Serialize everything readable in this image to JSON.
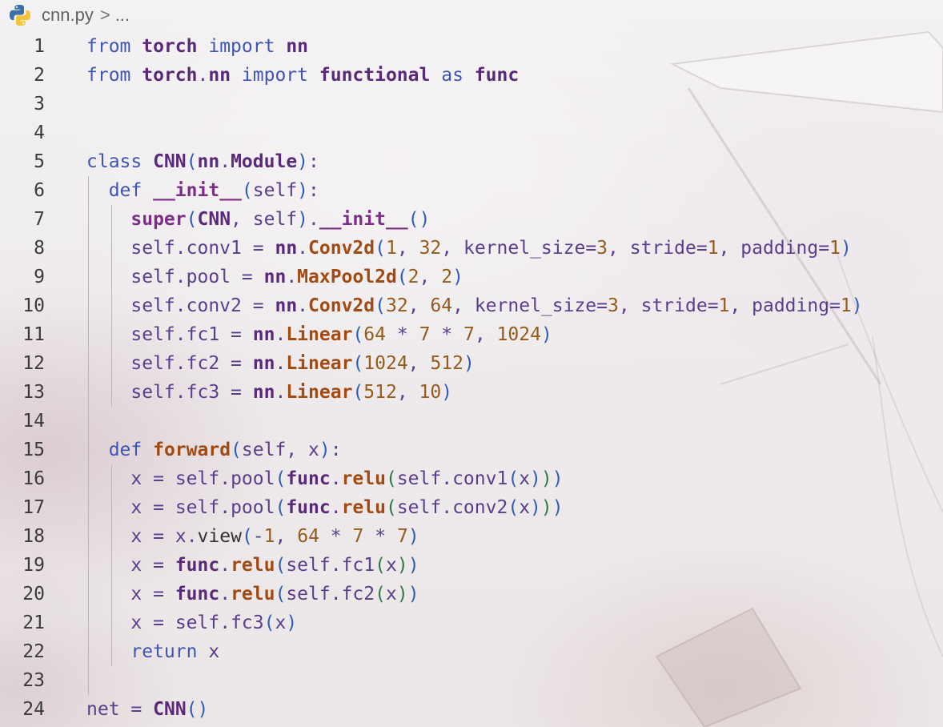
{
  "breadcrumb": {
    "file": "cnn.py",
    "separator": ">",
    "ellipsis": "..."
  },
  "icons": {
    "file_type": "python-icon",
    "separator": "chevron-right-icon"
  },
  "colors": {
    "keyword": "#3f55b4",
    "module": "#5a2a7a",
    "identifier": "#5a3e8c",
    "function_call": "#a04a14",
    "number": "#955b1c",
    "bracket_level1": "#2f5db5",
    "bracket_level2": "#2f7a4a"
  },
  "code_lines": [
    {
      "n": "1",
      "text": "from torch import nn"
    },
    {
      "n": "2",
      "text": "from torch.nn import functional as func"
    },
    {
      "n": "3",
      "text": ""
    },
    {
      "n": "4",
      "text": ""
    },
    {
      "n": "5",
      "text": "class CNN(nn.Module):"
    },
    {
      "n": "6",
      "text": "  def __init__(self):"
    },
    {
      "n": "7",
      "text": "    super(CNN, self).__init__()"
    },
    {
      "n": "8",
      "text": "    self.conv1 = nn.Conv2d(1, 32, kernel_size=3, stride=1, padding=1)"
    },
    {
      "n": "9",
      "text": "    self.pool = nn.MaxPool2d(2, 2)"
    },
    {
      "n": "10",
      "text": "    self.conv2 = nn.Conv2d(32, 64, kernel_size=3, stride=1, padding=1)"
    },
    {
      "n": "11",
      "text": "    self.fc1 = nn.Linear(64 * 7 * 7, 1024)"
    },
    {
      "n": "12",
      "text": "    self.fc2 = nn.Linear(1024, 512)"
    },
    {
      "n": "13",
      "text": "    self.fc3 = nn.Linear(512, 10)"
    },
    {
      "n": "14",
      "text": ""
    },
    {
      "n": "15",
      "text": "  def forward(self, x):"
    },
    {
      "n": "16",
      "text": "    x = self.pool(func.relu(self.conv1(x)))"
    },
    {
      "n": "17",
      "text": "    x = self.pool(func.relu(self.conv2(x)))"
    },
    {
      "n": "18",
      "text": "    x = x.view(-1, 64 * 7 * 7)"
    },
    {
      "n": "19",
      "text": "    x = func.relu(self.fc1(x))"
    },
    {
      "n": "20",
      "text": "    x = func.relu(self.fc2(x))"
    },
    {
      "n": "21",
      "text": "    x = self.fc3(x)"
    },
    {
      "n": "22",
      "text": "    return x"
    },
    {
      "n": "23",
      "text": ""
    },
    {
      "n": "24",
      "text": "net = CNN()"
    }
  ]
}
